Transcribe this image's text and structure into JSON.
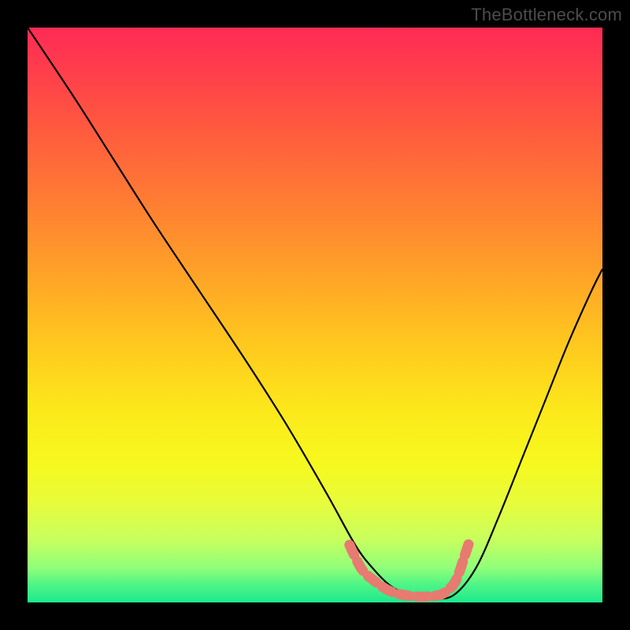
{
  "watermark": "TheBottleneck.com",
  "colors": {
    "background": "#000000",
    "curve": "#000000",
    "marker": "#e77a71",
    "gradient_top": "#ff2a55",
    "gradient_bottom": "#1de98d"
  },
  "chart_data": {
    "type": "line",
    "title": "",
    "xlabel": "",
    "ylabel": "",
    "xlim": [
      0,
      100
    ],
    "ylim": [
      0,
      100
    ],
    "grid": false,
    "series": [
      {
        "name": "bottleneck-curve",
        "x": [
          0,
          8,
          15,
          22,
          30,
          38,
          45,
          52,
          57,
          60,
          63,
          66,
          70,
          74,
          78,
          82,
          86,
          90,
          94,
          98,
          100
        ],
        "values": [
          100,
          88,
          77,
          66,
          54,
          42,
          31,
          19,
          10,
          6,
          3,
          1.5,
          0.8,
          1.2,
          6,
          15,
          25,
          35,
          45,
          54,
          58
        ]
      }
    ],
    "markers": {
      "name": "highlight-band",
      "style": "dashed-thick",
      "color": "#e77a71",
      "x": [
        56,
        58,
        60,
        63,
        66,
        69,
        72,
        74,
        75,
        76,
        77
      ],
      "values": [
        10,
        6,
        4,
        2,
        1.2,
        1.0,
        1.4,
        3,
        5,
        8,
        11
      ]
    }
  }
}
